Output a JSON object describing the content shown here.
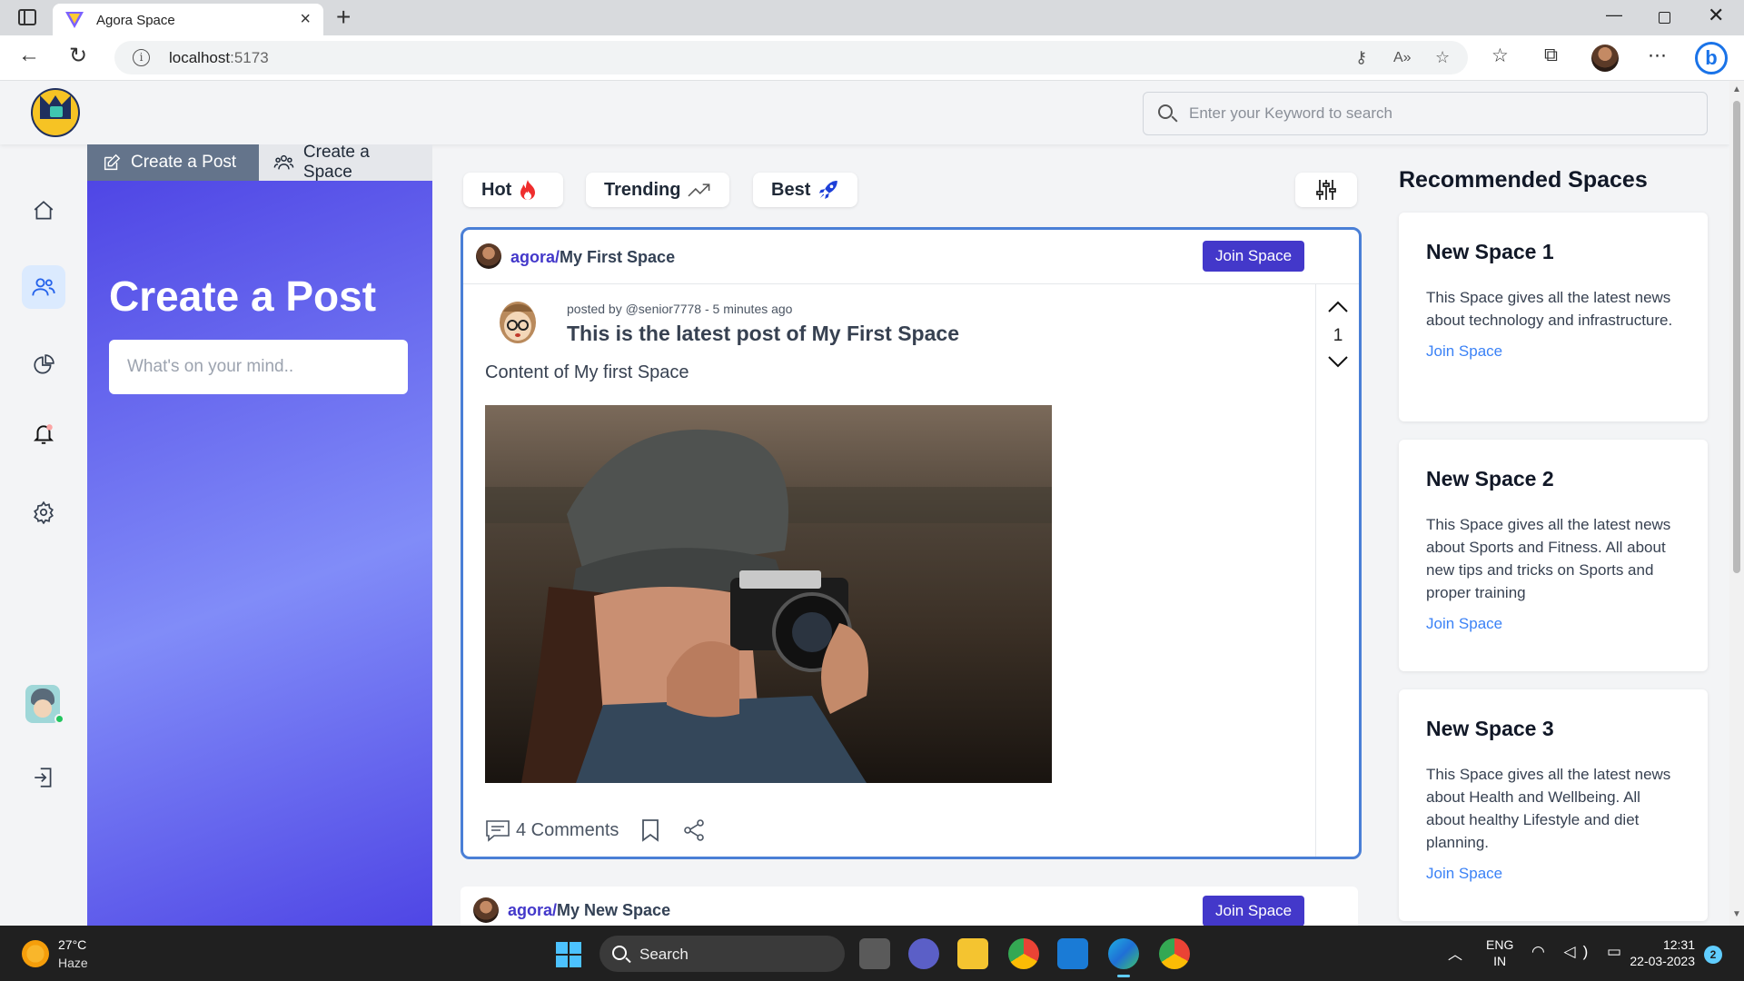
{
  "browser": {
    "tab_title": "Agora Space",
    "url_host": "localhost",
    "url_port": ":5173",
    "colors": {
      "tab_logo": "#7b61ff",
      "bing": "#1a73e8"
    }
  },
  "header": {
    "search_placeholder": "Enter your Keyword to search"
  },
  "sidebar": {
    "icons": [
      "home-icon",
      "users-icon",
      "pie-chart-icon",
      "bell-icon",
      "settings-icon",
      "user-avatar",
      "logout-icon"
    ],
    "active": "users-icon"
  },
  "create": {
    "tabs": [
      {
        "label": "Create a Post",
        "icon": "pencil-square-icon"
      },
      {
        "label": "Create a Space",
        "icon": "users-icon"
      }
    ],
    "heading": "Create a Post",
    "input_placeholder": "What's on your mind.."
  },
  "filters": [
    {
      "label": "Hot",
      "icon": "fire-icon"
    },
    {
      "label": "Trending",
      "icon": "trending-up-icon"
    },
    {
      "label": "Best",
      "icon": "rocket-icon"
    }
  ],
  "post": {
    "space_prefix": "agora/",
    "space_name": "My First Space",
    "join_label": "Join Space",
    "posted_by": "posted by @senior7778 - 5 minutes ago",
    "title": "This is the latest post of My First Space",
    "content": "Content of My first Space",
    "votes": "1",
    "comments_label": "4 Comments"
  },
  "post2": {
    "space_prefix": "agora/",
    "space_name": "My New Space",
    "join_label": "Join Space"
  },
  "recommended": {
    "title": "Recommended Spaces",
    "spaces": [
      {
        "name": "New Space 1",
        "desc": "This Space gives all the latest news about technology and infrastructure.",
        "join": "Join Space"
      },
      {
        "name": "New Space 2",
        "desc": "This Space gives all the latest news about Sports and Fitness. All about new tips and tricks on Sports and proper training",
        "join": "Join Space"
      },
      {
        "name": "New Space 3",
        "desc": "This Space gives all the latest news about Health and Wellbeing. All about healthy Lifestyle and diet planning.",
        "join": "Join Space"
      }
    ]
  },
  "taskbar": {
    "temp": "27°C",
    "condition": "Haze",
    "search_label": "Search",
    "lang_1": "ENG",
    "lang_2": "IN",
    "time": "12:31",
    "date": "22-03-2023",
    "notification_count": "2"
  },
  "colors": {
    "accent": "#4338ca",
    "link": "#3b82f6",
    "post_border": "#4a7fd6",
    "panel_gradient_start": "#4f46e5",
    "panel_gradient_mid": "#818cf8"
  }
}
